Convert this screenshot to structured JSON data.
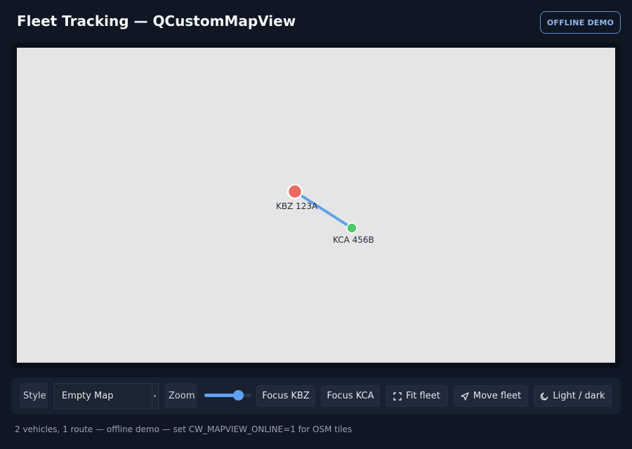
{
  "header": {
    "title": "Fleet Tracking — QCustomMapView",
    "badge": "OFFLINE DEMO"
  },
  "map": {
    "background_color": "#e5e5e5",
    "route_color": "#5ea2ef",
    "vehicles": [
      {
        "id": "KBZ 123A",
        "label": "KBZ 123A",
        "color": "#ec6b63"
      },
      {
        "id": "KCA 456B",
        "label": "KCA 456B",
        "color": "#4cc86a"
      }
    ]
  },
  "toolbar": {
    "style_label": "Style",
    "style_value": "Empty Map",
    "zoom_label": "Zoom",
    "zoom_level_fraction": 0.6,
    "buttons": {
      "focus_kbz": "Focus KBZ",
      "focus_kca": "Focus KCA",
      "fit_fleet": "Fit fleet",
      "move_fleet": "Move fleet",
      "light_dark": "Light / dark"
    },
    "icons": {
      "fit_fleet": "fit-frame-icon",
      "move_fleet": "navigation-arrow-icon",
      "light_dark": "moon-icon"
    }
  },
  "status": {
    "text": "2 vehicles, 1 route — offline demo — set CW_MAPVIEW_ONLINE=1 for OSM tiles"
  }
}
